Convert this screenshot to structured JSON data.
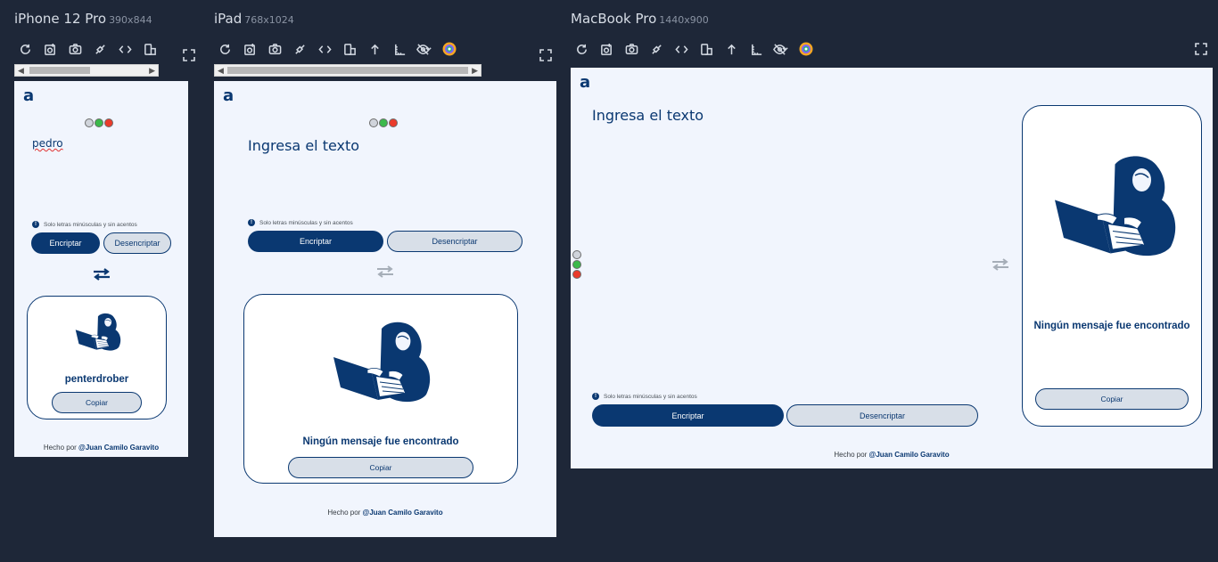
{
  "devices": [
    {
      "name": "iPhone 12 Pro",
      "size": "390x844"
    },
    {
      "name": "iPad",
      "size": "768x1024"
    },
    {
      "name": "MacBook Pro",
      "size": "1440x900"
    }
  ],
  "toolbar_icons": [
    "refresh-icon",
    "screenshot-icon",
    "camera-icon",
    "network-icon",
    "code-icon",
    "rotate-icon",
    "scroll-up-icon",
    "ruler-icon",
    "hide-icon",
    "chevron-down-icon",
    "color-palette-icon"
  ],
  "app": {
    "logo": "a",
    "placeholder": "Ingresa el texto",
    "mobile_input_value": "pedro",
    "hint": "Solo letras minúsculas y sin acentos",
    "encrypt_label": "Encriptar",
    "decrypt_label": "Desencriptar",
    "copy_label": "Copiar",
    "mobile_result": "penterdrober",
    "empty_message": "Ningún mensaje fue encontrado",
    "footer_prefix": "Hecho por ",
    "footer_author": "@Juan Camilo Garavito"
  },
  "colors": {
    "primary": "#0a3871",
    "background": "#f1f5fd",
    "dot_gray": "#d0d4db",
    "dot_green": "#3cb94b",
    "dot_red": "#ea3b2b"
  }
}
